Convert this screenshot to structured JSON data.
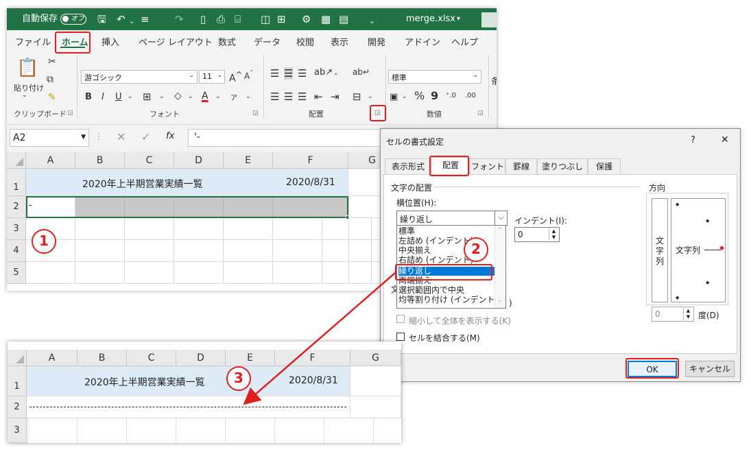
{
  "titlebar": {
    "autosave_label": "自動保存",
    "autosave_state": "オフ",
    "filename": "merge.xlsx"
  },
  "menu": [
    "ファイル",
    "ホーム",
    "挿入",
    "ページ レイアウト",
    "数式",
    "データ",
    "校閲",
    "表示",
    "開発",
    "アドイン",
    "ヘルプ"
  ],
  "ribbon": {
    "paste_label": "貼り付け",
    "clipboard_group": "クリップボード",
    "font_name": "游ゴシック",
    "font_size": "11",
    "font_group": "フォント",
    "align_group": "配置",
    "number_format": "標準",
    "number_group": "数値"
  },
  "formula_bar": {
    "name_box": "A2",
    "formula": "'-"
  },
  "sheet": {
    "columns": [
      "A",
      "B",
      "C",
      "D",
      "E",
      "F",
      "G"
    ],
    "rows": [
      "1",
      "2",
      "3",
      "4",
      "5"
    ],
    "title": "2020年上半期営業実績一覧",
    "date": "2020/8/31",
    "a2_value": "-"
  },
  "result_sheet": {
    "columns": [
      "A",
      "B",
      "C",
      "D",
      "E",
      "F",
      "G"
    ],
    "rows": [
      "1",
      "2",
      "3"
    ],
    "title": "2020年上半期営業実績一覧",
    "date": "2020/8/31"
  },
  "dialog": {
    "title": "セルの書式設定",
    "help": "?",
    "close": "✕",
    "tabs": [
      "表示形式",
      "配置",
      "フォント",
      "罫線",
      "塗りつぶし",
      "保護"
    ],
    "section_alignment": "文字の配置",
    "horizontal_label": "横位置(H):",
    "horizontal_value": "繰り返し",
    "indent_label": "インデント(I):",
    "indent_value": "0",
    "options": [
      "標準",
      "左詰め (インデント)",
      "中央揃え",
      "右詰め (インデント)",
      "繰り返し",
      "両端揃え",
      "選択範囲内で中央",
      "均等割り付け (インデント)"
    ],
    "shrink_label": "縮小して全体を表示する(K)",
    "merge_label": "セルを結合する(M)",
    "section_orientation": "方向",
    "vertical_text": "文字列",
    "horizontal_text": "文字列",
    "degree_value": "0",
    "degree_label": "度(D)",
    "ok": "OK",
    "cancel": "キャンセル",
    "partial_letter": "文",
    "partial_paren": ")"
  },
  "callouts": [
    "1",
    "2",
    "3"
  ],
  "colors": {
    "excel_green": "#217346",
    "highlight_red": "#e01e1e",
    "title_fill": "#ddebf7",
    "selection_gray": "#c8c8c8",
    "list_select": "#0078d7"
  }
}
